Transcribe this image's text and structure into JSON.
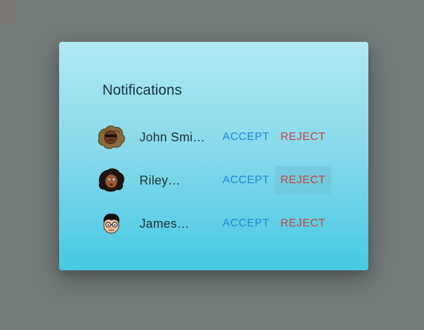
{
  "dialog": {
    "title": "Notifications"
  },
  "notifications": [
    {
      "name": "John Smi…",
      "avatar_icon": "avatar-curly-hair-sunglasses-icon",
      "accept_label": "ACCEPT",
      "reject_label": "REJECT"
    },
    {
      "name": "Riley…",
      "avatar_icon": "avatar-dark-hair-icon",
      "accept_label": "ACCEPT",
      "reject_label": "REJECT"
    },
    {
      "name": "James…",
      "avatar_icon": "avatar-glasses-icon",
      "accept_label": "ACCEPT",
      "reject_label": "REJECT"
    }
  ],
  "colors": {
    "backdrop": "#737b7b",
    "accept": "#1a8ad6",
    "reject": "#c8403e"
  }
}
